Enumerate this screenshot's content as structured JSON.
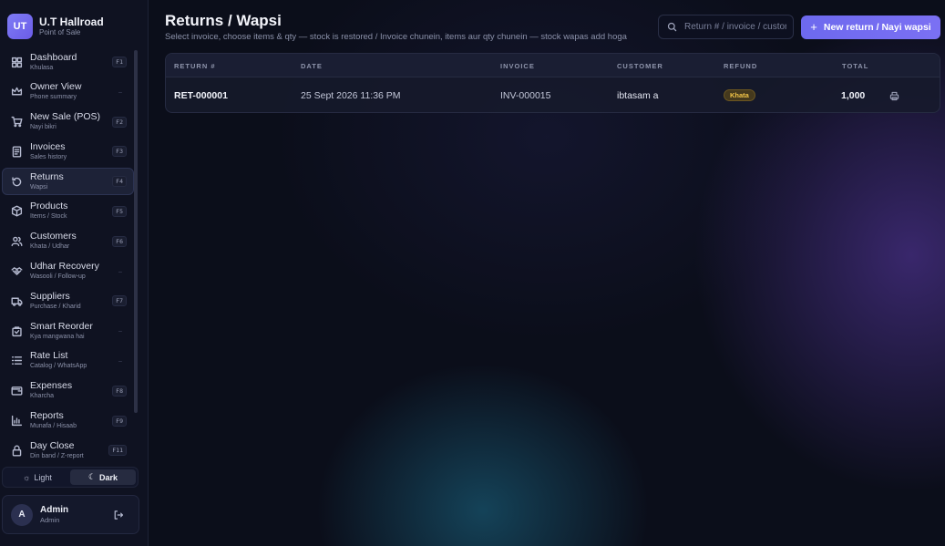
{
  "brand": {
    "initials": "UT",
    "name": "U.T Hallroad",
    "subtitle": "Point of Sale"
  },
  "sidebar": {
    "items": [
      {
        "label": "Dashboard",
        "sub": "Khulasa",
        "key": "F1",
        "icon": "dashboard-icon",
        "active": false
      },
      {
        "label": "Owner View",
        "sub": "Phone summary",
        "key": "—",
        "icon": "crown-icon",
        "active": false
      },
      {
        "label": "New Sale (POS)",
        "sub": "Nayi bikri",
        "key": "F2",
        "icon": "cart-icon",
        "active": false
      },
      {
        "label": "Invoices",
        "sub": "Sales history",
        "key": "F3",
        "icon": "invoice-icon",
        "active": false
      },
      {
        "label": "Returns",
        "sub": "Wapsi",
        "key": "F4",
        "icon": "return-icon",
        "active": true
      },
      {
        "label": "Products",
        "sub": "Items / Stock",
        "key": "F5",
        "icon": "box-icon",
        "active": false
      },
      {
        "label": "Customers",
        "sub": "Khata / Udhar",
        "key": "F6",
        "icon": "users-icon",
        "active": false
      },
      {
        "label": "Udhar Recovery",
        "sub": "Wasooli / Follow-up",
        "key": "—",
        "icon": "handshake-icon",
        "active": false
      },
      {
        "label": "Suppliers",
        "sub": "Purchase / Kharid",
        "key": "F7",
        "icon": "truck-icon",
        "active": false
      },
      {
        "label": "Smart Reorder",
        "sub": "Kya mangwana hai",
        "key": "—",
        "icon": "reorder-icon",
        "active": false
      },
      {
        "label": "Rate List",
        "sub": "Catalog / WhatsApp",
        "key": "—",
        "icon": "list-icon",
        "active": false
      },
      {
        "label": "Expenses",
        "sub": "Kharcha",
        "key": "F8",
        "icon": "wallet-icon",
        "active": false
      },
      {
        "label": "Reports",
        "sub": "Munafa / Hisaab",
        "key": "F9",
        "icon": "chart-icon",
        "active": false
      },
      {
        "label": "Day Close",
        "sub": "Din band / Z-report",
        "key": "F11",
        "icon": "lock-icon",
        "active": false
      }
    ]
  },
  "theme": {
    "light_label": "Light",
    "dark_label": "Dark",
    "selected": "dark"
  },
  "user": {
    "initial": "A",
    "name": "Admin",
    "role": "Admin"
  },
  "header": {
    "title": "Returns / Wapsi",
    "subtitle": "Select invoice, choose items & qty — stock is restored / Invoice chunein, items aur qty chunein — stock wapas add hoga",
    "search_placeholder": "Return # / invoice / customer",
    "new_button_label": "New return / Nayi wapsi"
  },
  "table": {
    "columns": [
      "RETURN #",
      "DATE",
      "INVOICE",
      "CUSTOMER",
      "REFUND",
      "TOTAL"
    ],
    "rows": [
      {
        "return_no": "RET-000001",
        "date": "25 Sept 2026 11:36 PM",
        "invoice": "INV-000015",
        "customer": "ibtasam a",
        "refund": "Khata",
        "total": "1,000"
      }
    ]
  },
  "colors": {
    "accent": "#7b70f3",
    "badge_text": "#f3c548",
    "background": "#0b0e1a"
  }
}
